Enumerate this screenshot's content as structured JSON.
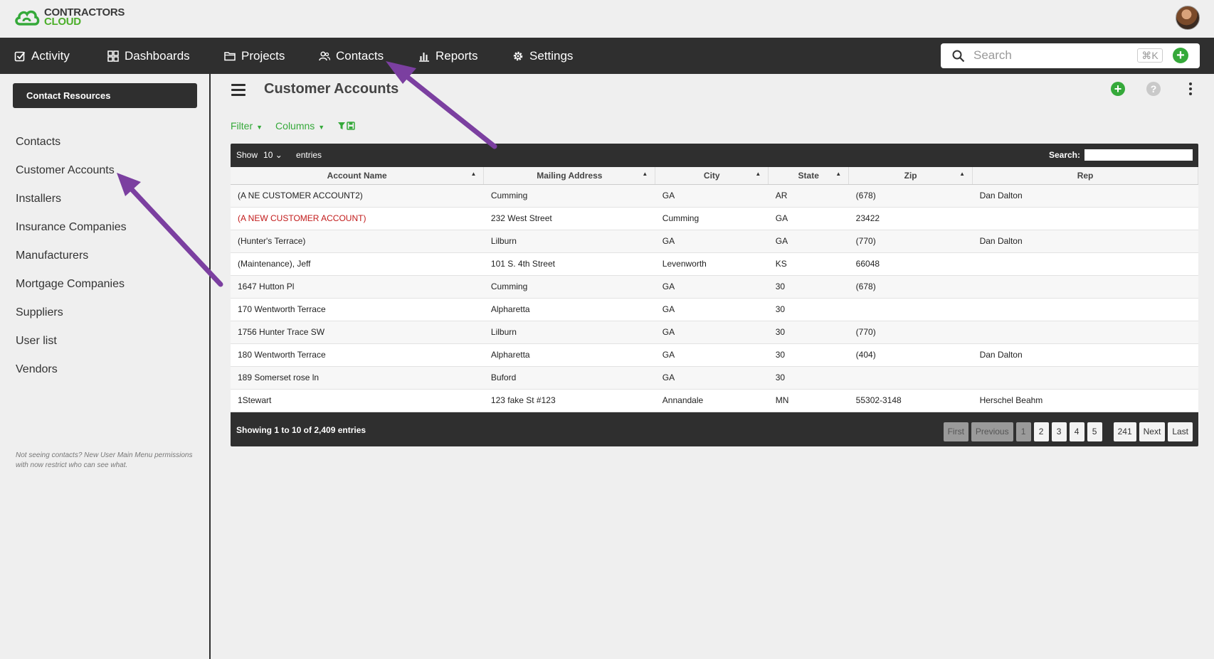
{
  "app": {
    "logo_line1": "CONTRACTORS",
    "logo_line2": "CLOUD",
    "brand_color": "#35a93a"
  },
  "nav": {
    "items": [
      {
        "label": "Activity",
        "icon": "checkbox-icon"
      },
      {
        "label": "Dashboards",
        "icon": "grid-icon"
      },
      {
        "label": "Projects",
        "icon": "folder-icon"
      },
      {
        "label": "Contacts",
        "icon": "people-icon"
      },
      {
        "label": "Reports",
        "icon": "bar-chart-icon"
      },
      {
        "label": "Settings",
        "icon": "gear-icon"
      }
    ],
    "search_placeholder": "Search",
    "shortcut": "⌘K"
  },
  "sidebar": {
    "button": "Contact Resources",
    "items": [
      "Contacts",
      "Customer Accounts",
      "Installers",
      "Insurance Companies",
      "Manufacturers",
      "Mortgage Companies",
      "Suppliers",
      "User list",
      "Vendors"
    ],
    "note": "Not seeing contacts? New User Main Menu permissions with now restrict who can see what."
  },
  "page": {
    "title": "Customer Accounts",
    "filter_label": "Filter",
    "columns_label": "Columns"
  },
  "table": {
    "show_label": "Show",
    "show_value": "10",
    "entries_label": "entries",
    "search_label": "Search:",
    "headers": [
      "Account Name",
      "Mailing Address",
      "City",
      "State",
      "Zip",
      "Rep"
    ],
    "rows": [
      [
        "(A NE CUSTOMER ACCOUNT2)",
        "Cumming",
        "GA",
        "AR",
        "(678)",
        "Dan Dalton"
      ],
      [
        "(A NEW CUSTOMER ACCOUNT)",
        "232 West Street",
        "Cumming",
        "GA",
        "23422",
        ""
      ],
      [
        "(Hunter's Terrace)",
        "Lilburn",
        "GA",
        "GA",
        "(770)",
        "Dan Dalton"
      ],
      [
        "(Maintenance), Jeff",
        "101 S. 4th Street",
        "Levenworth",
        "KS",
        "66048",
        ""
      ],
      [
        "1647 Hutton Pl",
        "Cumming",
        "GA",
        "30",
        "(678)",
        ""
      ],
      [
        "170 Wentworth Terrace",
        "Alpharetta",
        "GA",
        "30",
        "",
        ""
      ],
      [
        "1756 Hunter Trace SW",
        "Lilburn",
        "GA",
        "30",
        "(770)",
        ""
      ],
      [
        "180 Wentworth Terrace",
        "Alpharetta",
        "GA",
        "30",
        "(404)",
        "Dan Dalton"
      ],
      [
        "189 Somerset rose ln",
        "Buford",
        "GA",
        "30",
        "",
        ""
      ],
      [
        "1Stewart",
        "123 fake St #123",
        "Annandale",
        "MN",
        "55302-3148",
        "Herschel Beahm"
      ]
    ],
    "info": "Showing 1 to 10 of 2,409 entries",
    "pager": [
      "First",
      "Previous",
      "1",
      "2",
      "3",
      "4",
      "5",
      "241",
      "Next",
      "Last"
    ],
    "highlight_color": "#c21a1a"
  },
  "annotation_color": "#7b3fa0"
}
